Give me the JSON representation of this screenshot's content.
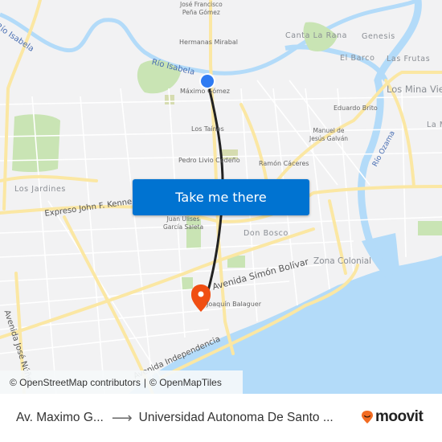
{
  "map": {
    "action_button": "Take me there",
    "attribution": {
      "osm": "© OpenStreetMap contributors",
      "separator": "|",
      "omt": "© OpenMapTiles"
    },
    "labels": {
      "rio_isabela_west": "Río Isabela",
      "rio_isabela_east": "Río Isabela",
      "rio_ozama": "Río Ozama",
      "jose_francisco_pena_gomez_1": "José Francisco",
      "jose_francisco_pena_gomez_2": "Peña Gómez",
      "hermanas_mirabal": "Hermanas Mirabal",
      "maximo_gomez": "Máximo Gómez",
      "canta_la_rana": "Canta La Rana",
      "genesis": "Genesis",
      "el_barco": "El Barco",
      "las_frutas": "Las Frutas",
      "los_mina_viejo": "Los Mina Viej",
      "la_m": "La M",
      "eduardo_brito": "Eduardo Brito",
      "los_tainos": "Los Taínos",
      "manuel_1": "Manuel de",
      "manuel_2": "Jesús Galván",
      "pedro_livio": "Pedro Livio Cedeño",
      "ramon_caceres": "Ramón Cáceres",
      "los_jardines": "Los Jardines",
      "expreso_jfk": "Expreso John F. Kenne",
      "juan_ulises_1": "Juan Ulises",
      "juan_ulises_2": "García Saleta",
      "don_bosco": "Don Bosco",
      "zona_colonial": "Zona Colonial",
      "av_simon_bolivar": "Avenida Simón Bolívar",
      "joaquin_balaguer": "Joaquín Balaguer",
      "av_jose_nunez": "Avenida José Núñe",
      "av_independencia": "Avenida Independencia"
    },
    "colors": {
      "water": "#b3dbf9",
      "park": "#c9e4b4",
      "major_road": "#fbe7a3",
      "route": "#222222",
      "origin_marker": "#2f7bf2",
      "destination_marker": "#f04e12",
      "button": "#0073d1"
    }
  },
  "footer": {
    "origin": "Av. Maximo G...",
    "arrow": "⟶",
    "destination": "Universidad Autonoma De Santo ...",
    "brand": "moovit",
    "brand_color": "#f26b21"
  }
}
